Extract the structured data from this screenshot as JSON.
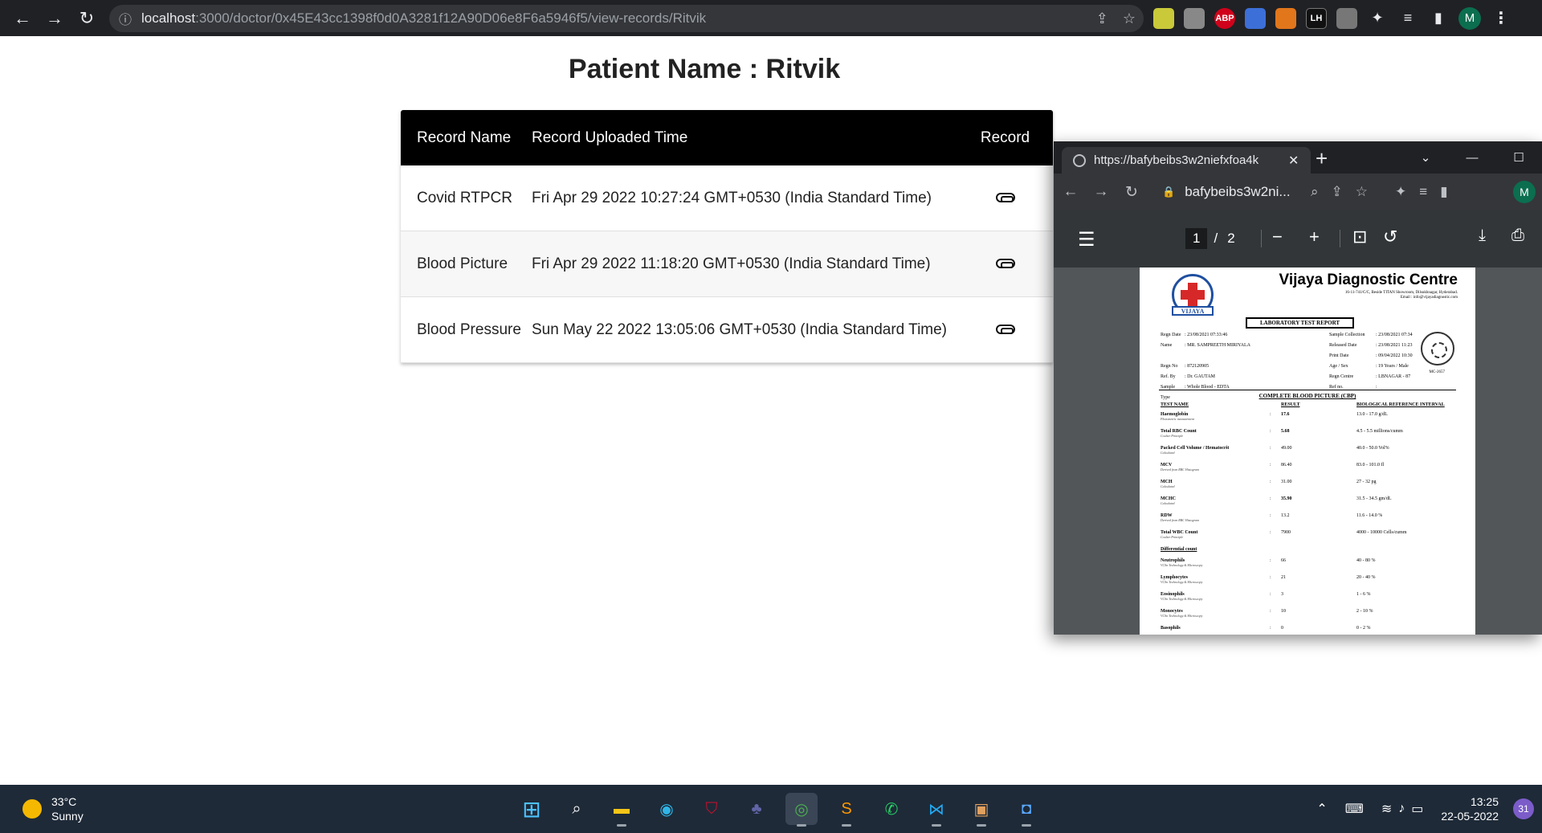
{
  "browser": {
    "url_host": "localhost",
    "url_rest": ":3000/doctor/0x45E43cc1398f0d0A3281f12A90D06e8F6a5946f5/view-records/Ritvik",
    "profile_initial": "M",
    "extensions": [
      "ABP",
      "LH"
    ]
  },
  "page": {
    "title": "Patient Name : Ritvik",
    "table": {
      "headers": [
        "Record Name",
        "Record Uploaded Time",
        "Record"
      ],
      "rows": [
        {
          "name": "Covid RTPCR",
          "time": "Fri Apr 29 2022 10:27:24 GMT+0530 (India Standard Time)"
        },
        {
          "name": "Blood Picture",
          "time": "Fri Apr 29 2022 11:18:20 GMT+0530 (India Standard Time)"
        },
        {
          "name": "Blood Pressure",
          "time": "Sun May 22 2022 13:05:06 GMT+0530 (India Standard Time)"
        }
      ]
    }
  },
  "popup": {
    "tab_title": "https://bafybeibs3w2niefxfoa4k",
    "omnibox": "bafybeibs3w2ni...",
    "profile_initial": "M",
    "pdf": {
      "current_page": "1",
      "page_sep": "/",
      "total_pages": "2"
    },
    "document": {
      "lab_name": "Vijaya Diagnostic Centre",
      "logo_text": "VIJAYA",
      "address": "16-11-741/C/C, Beside TITAN Showroom, Dilsukhnagar, Hyderabad.",
      "email": "Email : info@vijayadiagnostic.com",
      "report_title": "LABORATORY TEST REPORT",
      "meta_left": [
        {
          "label": "Regn Date",
          "value": ": 23/08/2021 07:33:46"
        },
        {
          "label": "Name",
          "value": ": MR. SAMPREETH MIRIYALA"
        },
        {
          "label": "",
          "value": ""
        },
        {
          "label": "Regn No",
          "value": ": 872120905"
        },
        {
          "label": "Ref. By",
          "value": ": Dr. GAUTAM"
        },
        {
          "label": "Sample Type",
          "value": ": Whole Blood - EDTA"
        }
      ],
      "meta_right": [
        {
          "label": "Sample Collection",
          "value": ": 23/08/2021 07:34"
        },
        {
          "label": "Released Date",
          "value": ": 23/08/2021 11:23"
        },
        {
          "label": "Print Date",
          "value": ": 09/04/2022 10:30"
        },
        {
          "label": "Age / Sex",
          "value": ": 19 Years / Male"
        },
        {
          "label": "Regn Centre",
          "value": ": LBNAGAR - 87"
        },
        {
          "label": "Ref no.",
          "value": ":"
        }
      ],
      "seal_text": "MC-2657",
      "section_title": "COMPLETE BLOOD PICTURE (CBP)",
      "columns": [
        "TEST NAME",
        "RESULT",
        "BIOLOGICAL REFERENCE INTERVAL"
      ],
      "tests": [
        {
          "name": "Haemoglobin",
          "method": "Photometric measurement",
          "result": "17.6",
          "ref": "13.0 - 17.0 g/dL"
        },
        {
          "name": "Total RBC Count",
          "method": "Coulter Principle",
          "result": "5.68",
          "ref": "4.5 - 5.5 millions/cumm"
        },
        {
          "name": "Packed Cell Volume / Hematocrit",
          "method": "Calculated",
          "result": "49.00",
          "ref": "40.0 - 50.0 Vol%"
        },
        {
          "name": "MCV",
          "method": "Derived from RBC Histogram",
          "result": "86.40",
          "ref": "83.0 - 101.0 fl"
        },
        {
          "name": "MCH",
          "method": "Calculated",
          "result": "31.00",
          "ref": "27 - 32 pg"
        },
        {
          "name": "MCHC",
          "method": "Calculated",
          "result": "35.90",
          "ref": "31.5 - 34.5 gm/dL"
        },
        {
          "name": "RDW",
          "method": "Derived from RBC Histogram",
          "result": "13.2",
          "ref": "11.6 - 14.0 %"
        },
        {
          "name": "Total WBC Count",
          "method": "Coulter Principle",
          "result": "7900",
          "ref": "4000 - 10000 Cells/cumm"
        },
        {
          "name": "Differential count",
          "method": "",
          "result": "",
          "ref": ""
        },
        {
          "name": "Neutrophils",
          "method": "VCSn Technology & Microscopy",
          "result": "66",
          "ref": "40 - 80 %"
        },
        {
          "name": "Lymphocytes",
          "method": "VCSn Technology & Microscopy",
          "result": "21",
          "ref": "20 - 40 %"
        },
        {
          "name": "Eosinophils",
          "method": "VCSn Technology & Microscopy",
          "result": "3",
          "ref": "1 - 6 %"
        },
        {
          "name": "Monocytes",
          "method": "VCSn Technology & Microscopy",
          "result": "10",
          "ref": "2 - 10 %"
        },
        {
          "name": "Basophils",
          "method": "",
          "result": "0",
          "ref": "0 - 2 %"
        }
      ]
    }
  },
  "taskbar": {
    "temperature": "33°C",
    "condition": "Sunny",
    "time": "13:25",
    "date": "22-05-2022",
    "notifications": "31"
  }
}
